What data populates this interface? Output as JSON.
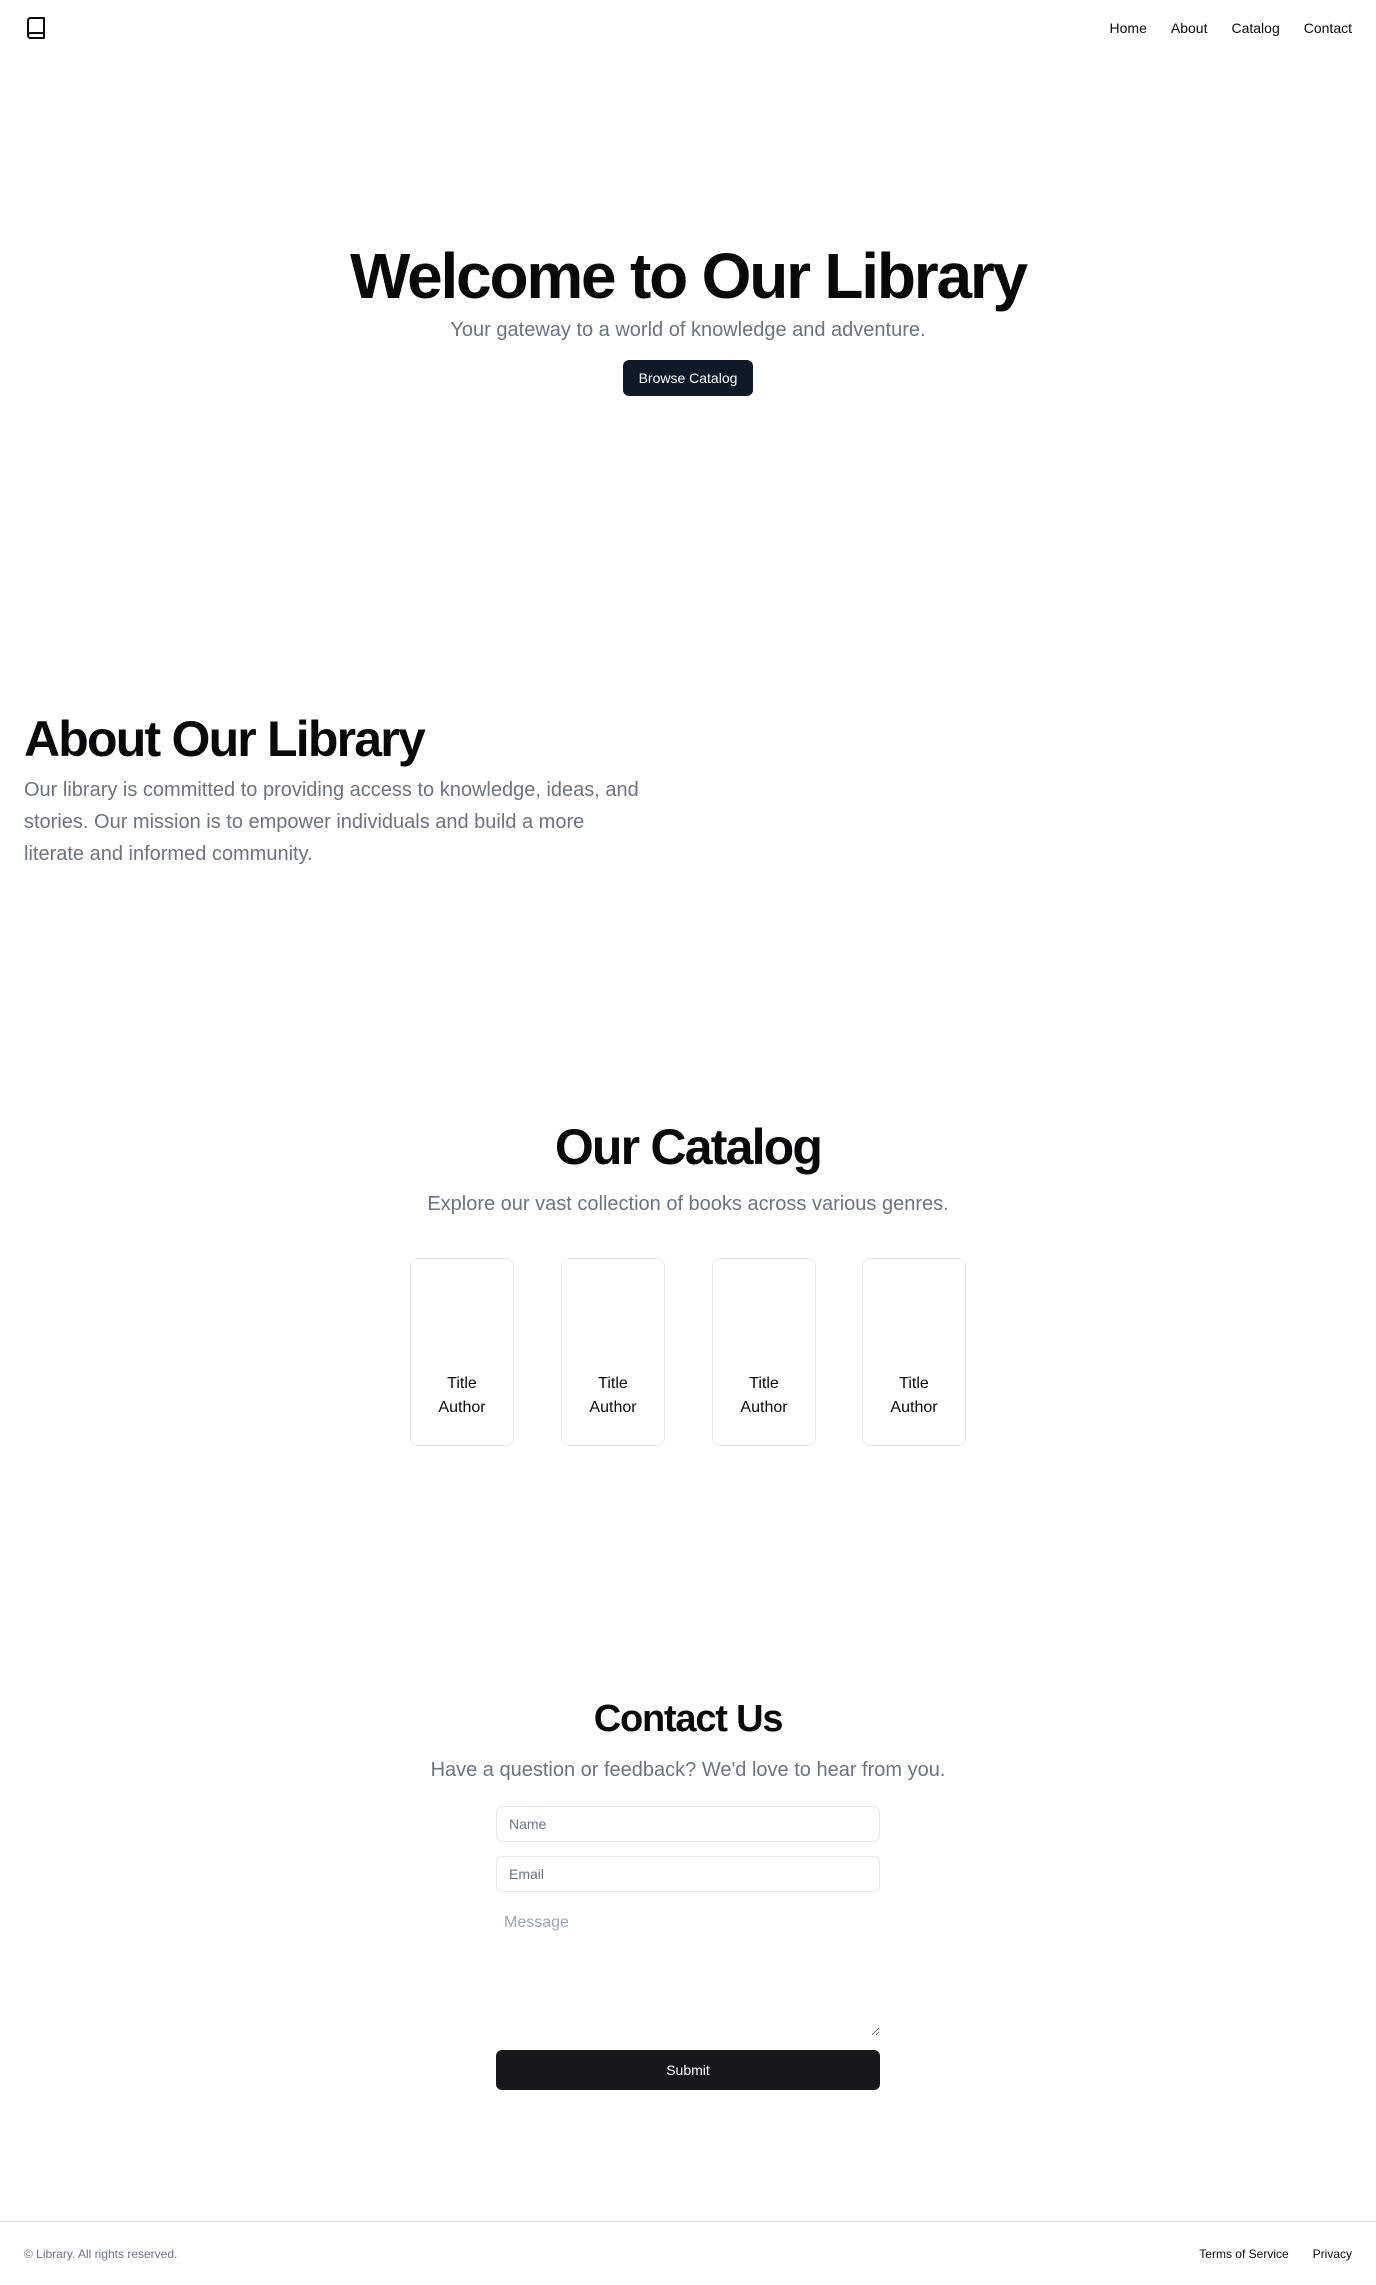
{
  "header": {
    "logo_icon": "book-icon",
    "nav": [
      "Home",
      "About",
      "Catalog",
      "Contact"
    ]
  },
  "hero": {
    "title": "Welcome to Our Library",
    "subtitle": "Your gateway to a world of knowledge and adventure.",
    "cta_label": "Browse Catalog"
  },
  "about": {
    "title": "About Our Library",
    "body": "Our library is committed to providing access to knowledge, ideas, and stories. Our mission is to empower individuals and build a more literate and informed community."
  },
  "catalog": {
    "title": "Our Catalog",
    "subtitle": "Explore our vast collection of books across various genres.",
    "books": [
      {
        "title": "Title",
        "author": "Author"
      },
      {
        "title": "Title",
        "author": "Author"
      },
      {
        "title": "Title",
        "author": "Author"
      },
      {
        "title": "Title",
        "author": "Author"
      }
    ]
  },
  "contact": {
    "title": "Contact Us",
    "subtitle": "Have a question or feedback? We'd love to hear from you.",
    "name_placeholder": "Name",
    "email_placeholder": "Email",
    "message_placeholder": "Message",
    "submit_label": "Submit"
  },
  "footer": {
    "copyright": "© Library. All rights reserved.",
    "links": [
      "Terms of Service",
      "Privacy"
    ]
  },
  "colors": {
    "primary_button": "#111827",
    "submit_button": "#18181b",
    "muted_text": "#6b7280",
    "border": "#e5e7eb"
  }
}
